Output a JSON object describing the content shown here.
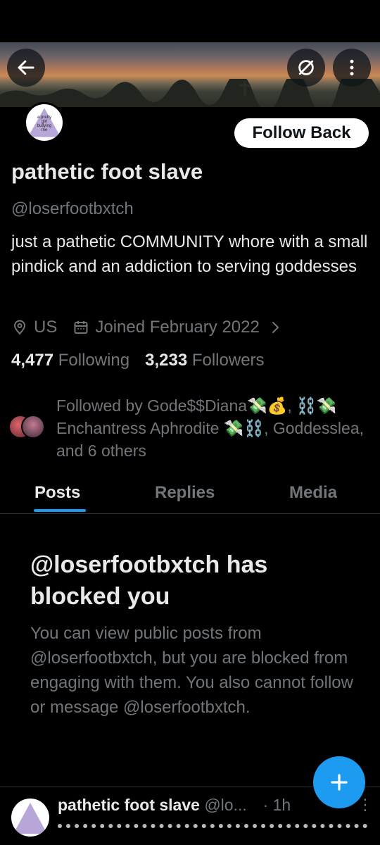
{
  "profile": {
    "avatar_text": "a pretty girl bullying me",
    "follow_back_label": "Follow Back",
    "name": "pathetic foot slave",
    "handle": "@loserfootbxtch",
    "bio": "just a pathetic COMMUNITY whore with a small pindick and an addiction to serving goddesses",
    "location": "US",
    "joined": "Joined February 2022",
    "following_count": "4,477",
    "following_label": " Following",
    "followers_count": "3,233",
    "followers_label": " Followers",
    "followed_by": "Followed by Gode$$Diana💸💰, ⛓️💸 Enchantress Aphrodite 💸⛓️, Goddesslea, and 6 others"
  },
  "tabs": [
    {
      "label": "Posts",
      "active": true
    },
    {
      "label": "Replies",
      "active": false
    },
    {
      "label": "Media",
      "active": false
    }
  ],
  "blocked_notice": {
    "title": "@loserfootbxtch has blocked you",
    "text": "You can view public posts from @loserfootbxtch, but you are blocked from engaging with them. You also cannot follow or message @loserfootbxtch."
  },
  "post_preview": {
    "avatar_text": "a pretty girl bullying",
    "name": "pathetic foot slave",
    "handle": "@lo...",
    "separator": "·",
    "time": "1h"
  },
  "icons": {
    "back": "arrow-left-icon",
    "hide": "eye-slash-icon",
    "more": "more-vertical-icon",
    "location": "location-pin-icon",
    "calendar": "calendar-icon",
    "chevron": "chevron-right-icon",
    "compose": "plus-icon"
  },
  "colors": {
    "accent": "#1d9bf0",
    "text_primary": "#e7e9ea",
    "text_secondary": "#71767b",
    "background": "#000000",
    "avatar_triangle": "#b9a6d8"
  }
}
